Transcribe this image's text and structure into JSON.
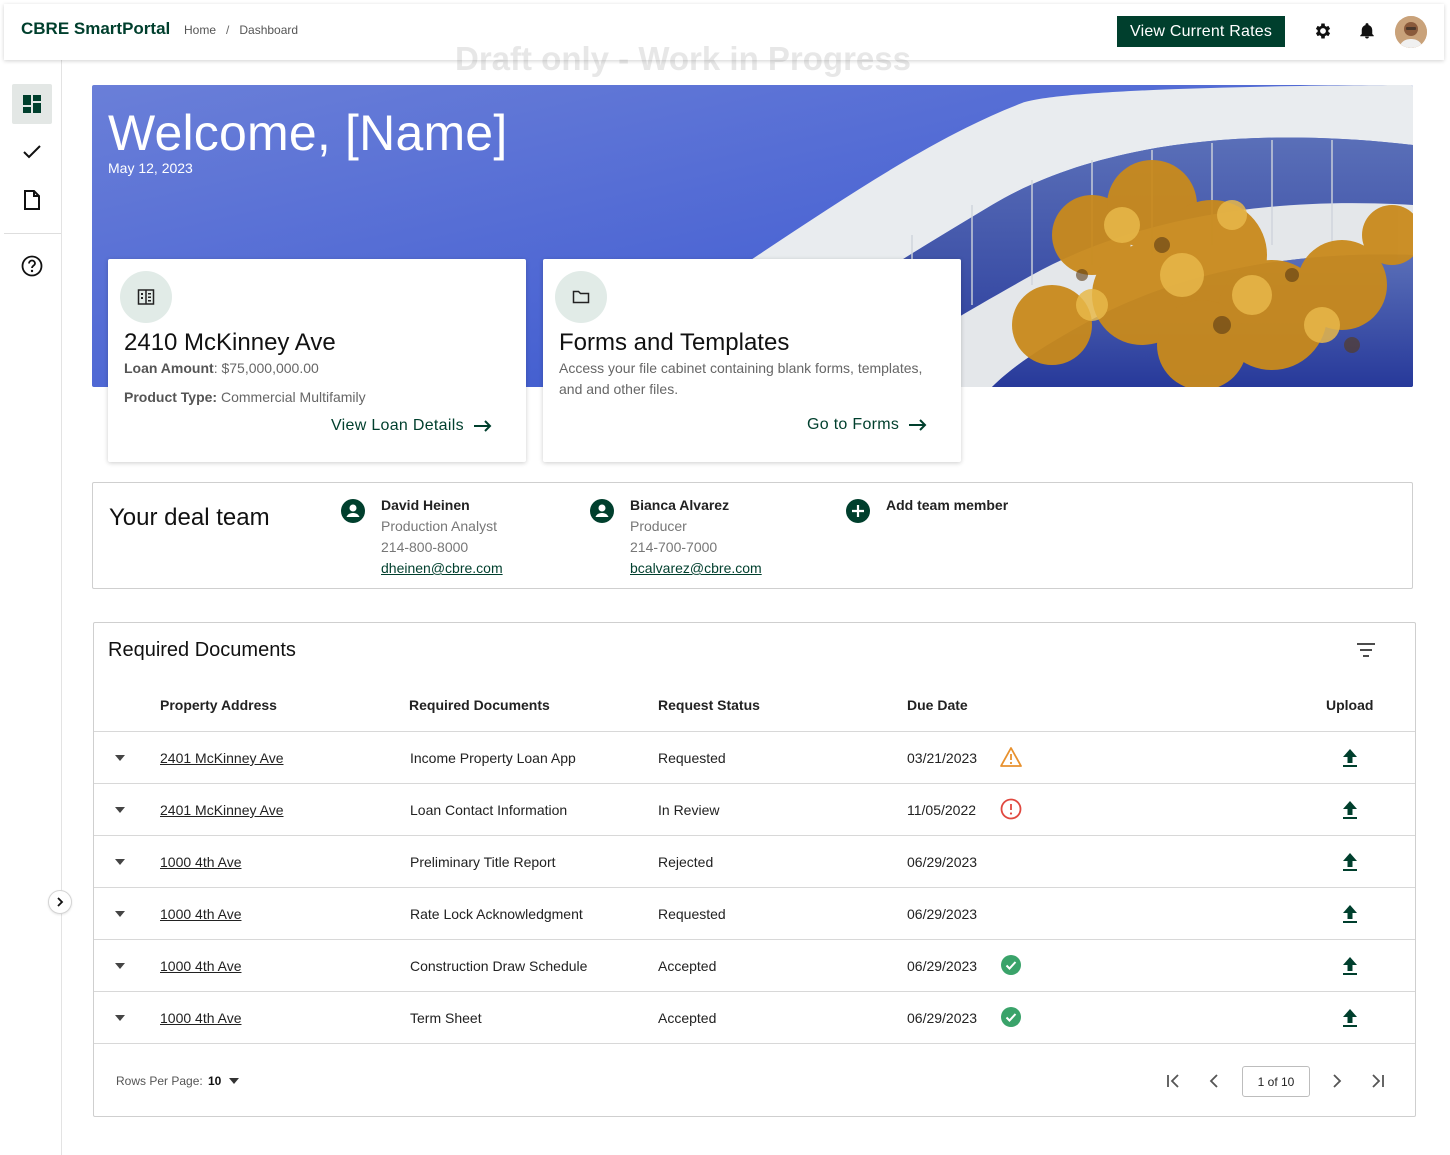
{
  "header": {
    "brand": "CBRE SmartPortal",
    "breadcrumb": [
      "Home",
      "Dashboard"
    ],
    "breadcrumb_sep": "/",
    "rates_button": "View Current Rates",
    "watermark": "Draft only - Work in Progress"
  },
  "sidebar": {
    "items": [
      {
        "icon": "dashboard-icon",
        "active": true
      },
      {
        "icon": "check-icon",
        "active": false
      },
      {
        "icon": "document-icon",
        "active": false
      },
      {
        "icon": "help-icon",
        "active": false
      }
    ]
  },
  "hero": {
    "title": "Welcome, [Name]",
    "date": "May 12, 2023"
  },
  "loan_card": {
    "title": "2410 McKinney Ave",
    "loan_amount_label": "Loan Amount",
    "loan_amount_value": ": $75,000,000.00",
    "product_type_label": "Product Type:",
    "product_type_value": " Commercial Multifamily",
    "link": "View Loan Details"
  },
  "forms_card": {
    "title": "Forms and Templates",
    "description_line1": "Access your file cabinet containing blank  forms, templates,",
    "description_line2": "and and other files.",
    "link": "Go to Forms"
  },
  "team": {
    "title": "Your deal team",
    "members": [
      {
        "name": "David Heinen",
        "role": "Production Analyst",
        "phone": "214-800-8000",
        "email": "dheinen@cbre.com"
      },
      {
        "name": "Bianca Alvarez",
        "role": "Producer",
        "phone": "214-700-7000",
        "email": "bcalvarez@cbre.com"
      }
    ],
    "add_label": "Add team member"
  },
  "documents": {
    "title": "Required Documents",
    "columns": [
      "Property Address",
      "Required Documents",
      "Request Status",
      "Due Date",
      "Upload"
    ],
    "rows": [
      {
        "address": "2401 McKinney Ave",
        "document": "Income Property Loan App",
        "status": "Requested",
        "due": "03/21/2023",
        "flag": "warning"
      },
      {
        "address": "2401 McKinney Ave",
        "document": "Loan Contact Information",
        "status": "In Review",
        "due": "11/05/2022",
        "flag": "overdue"
      },
      {
        "address": "1000 4th Ave",
        "document": "Preliminary Title Report",
        "status": "Rejected",
        "due": "06/29/2023",
        "flag": ""
      },
      {
        "address": "1000 4th Ave",
        "document": "Rate Lock Acknowledgment",
        "status": "Requested",
        "due": "06/29/2023",
        "flag": ""
      },
      {
        "address": "1000 4th Ave",
        "document": "Construction Draw Schedule",
        "status": "Accepted",
        "due": "06/29/2023",
        "flag": "complete"
      },
      {
        "address": "1000 4th Ave",
        "document": "Term Sheet",
        "status": "Accepted",
        "due": "06/29/2023",
        "flag": "complete"
      }
    ],
    "rows_per_page_label": "Rows Per Page:",
    "rows_per_page_value": "10",
    "page_indicator": "1 of 10"
  },
  "colors": {
    "brand_green": "#003f2d",
    "warning": "#e8912e",
    "error": "#e0483f",
    "success": "#3aa36a"
  }
}
